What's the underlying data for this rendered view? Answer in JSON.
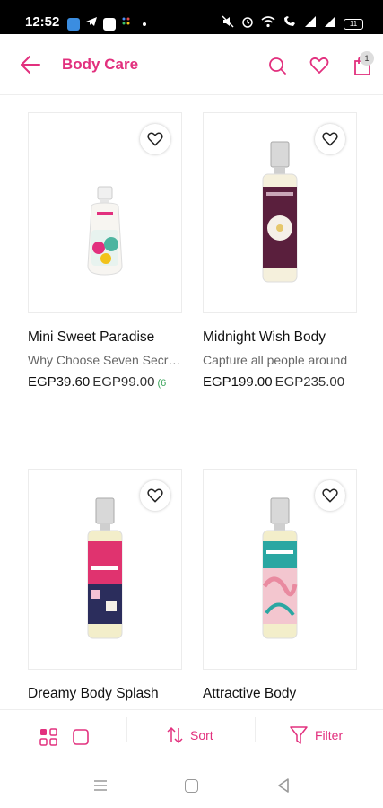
{
  "status_bar": {
    "time": "12:52",
    "battery": "11"
  },
  "app_bar": {
    "title": "Body Care",
    "bag_count": "1"
  },
  "products": [
    {
      "name": "Mini Sweet Paradise",
      "description": "Why Choose Seven Secrets Mini Sweet Paradise",
      "price": "EGP39.60",
      "old_price": "EGP99.00",
      "discount": "(6",
      "bottle": {
        "label_color": "#e8f3ef",
        "accent": "#4db5a0",
        "cap": "#f2f2f2",
        "type": "mini"
      }
    },
    {
      "name": "Midnight Wish Body",
      "description": "Capture all people around",
      "price": "EGP199.00",
      "old_price": "EGP235.00",
      "discount": "",
      "bottle": {
        "label_color": "#5a1f3d",
        "accent": "#f5f0e8",
        "cap": "#bfbfbf",
        "type": "spray"
      }
    },
    {
      "name": "Dreamy Body Splash",
      "description": "",
      "price": "",
      "old_price": "",
      "discount": "",
      "bottle": {
        "label_color": "#e0336f",
        "accent": "#2b2d5c",
        "cap": "#bfbfbf",
        "type": "spray"
      }
    },
    {
      "name": "Attractive Body",
      "description": "",
      "price": "",
      "old_price": "",
      "discount": "",
      "bottle": {
        "label_color": "#2aa7a2",
        "accent": "#e98aa0",
        "cap": "#bfbfbf",
        "type": "spray"
      }
    }
  ],
  "bottom_bar": {
    "sort_label": "Sort",
    "filter_label": "Filter"
  },
  "colors": {
    "accent": "#e2307e",
    "discount": "#3aa45a"
  }
}
